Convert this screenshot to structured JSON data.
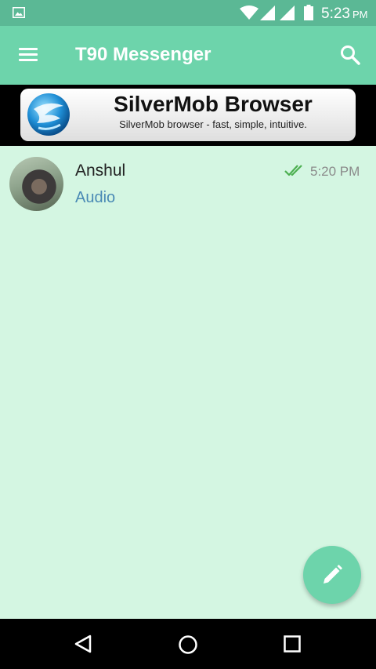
{
  "status_bar": {
    "time": "5:23",
    "ampm": "PM",
    "icons": [
      "gallery-icon",
      "wifi-icon",
      "signal-icon",
      "signal-icon",
      "battery-icon"
    ]
  },
  "app_bar": {
    "title": "T90 Messenger",
    "menu_icon": "menu-icon",
    "search_icon": "search-icon"
  },
  "ad": {
    "title": "SilverMob Browser",
    "subtitle": "SilverMob browser - fast, simple, intuitive."
  },
  "chats": [
    {
      "name": "Anshul",
      "last_message": "Audio",
      "time": "5:20 PM",
      "status": "double-check-icon"
    }
  ],
  "colors": {
    "status_bar": "#5bb895",
    "app_bar": "#6dd4ab",
    "background": "#d4f6e2",
    "message_preview": "#4a8ab5",
    "tick": "#4caf50"
  },
  "fab": {
    "icon": "pencil-icon"
  },
  "nav_bar": {
    "icons": [
      "back-icon",
      "home-icon",
      "recents-icon"
    ]
  }
}
